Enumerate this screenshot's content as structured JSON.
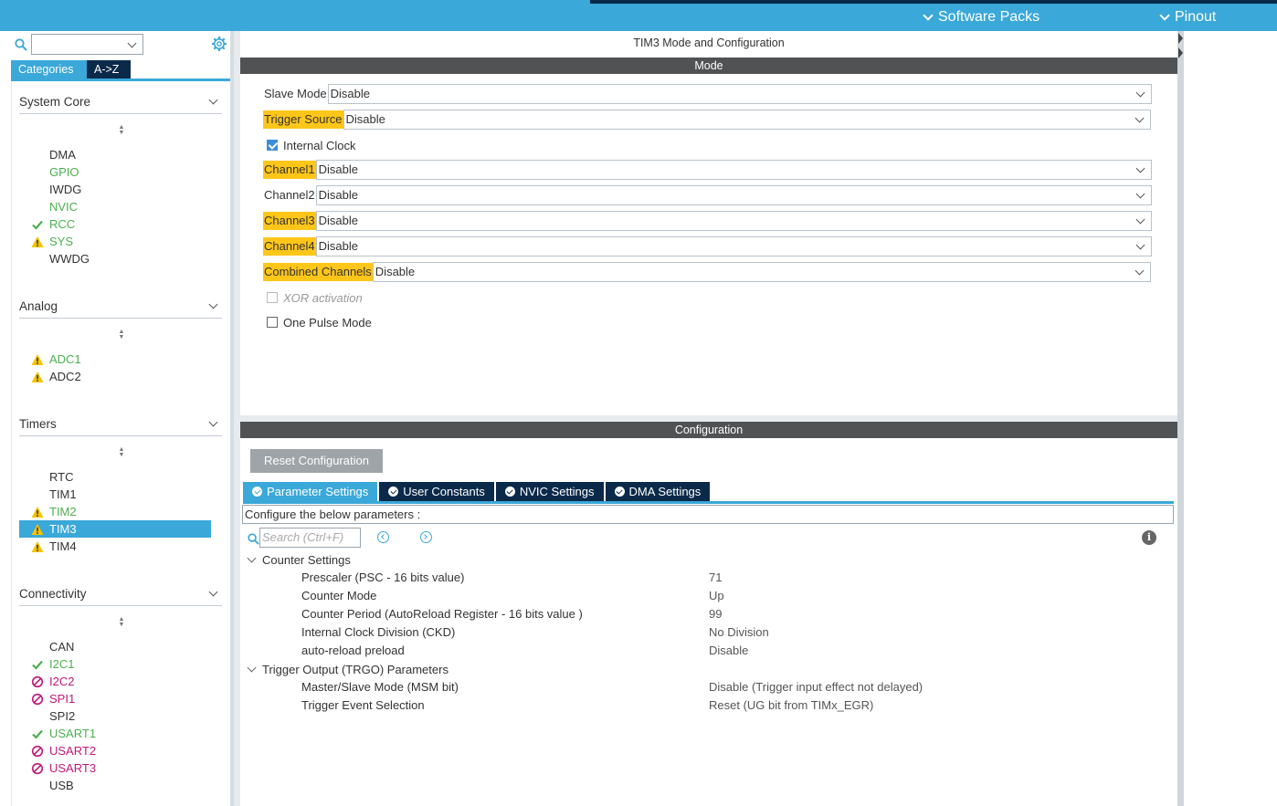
{
  "topbar": {
    "software_packs": "Software Packs",
    "pinout": "Pinout"
  },
  "left": {
    "tabs": {
      "categories": "Categories",
      "az": "A->Z"
    },
    "categories": [
      {
        "name": "System Core",
        "items": [
          {
            "label": "DMA",
            "status": "none",
            "color": "black"
          },
          {
            "label": "GPIO",
            "status": "none",
            "color": "green"
          },
          {
            "label": "IWDG",
            "status": "none",
            "color": "black"
          },
          {
            "label": "NVIC",
            "status": "none",
            "color": "green"
          },
          {
            "label": "RCC",
            "status": "check",
            "color": "green"
          },
          {
            "label": "SYS",
            "status": "warning",
            "color": "green"
          },
          {
            "label": "WWDG",
            "status": "none",
            "color": "black"
          }
        ]
      },
      {
        "name": "Analog",
        "items": [
          {
            "label": "ADC1",
            "status": "warning",
            "color": "green"
          },
          {
            "label": "ADC2",
            "status": "warning",
            "color": "black"
          }
        ]
      },
      {
        "name": "Timers",
        "items": [
          {
            "label": "RTC",
            "status": "none",
            "color": "black"
          },
          {
            "label": "TIM1",
            "status": "none",
            "color": "black"
          },
          {
            "label": "TIM2",
            "status": "warning",
            "color": "green"
          },
          {
            "label": "TIM3",
            "status": "warning",
            "color": "selected"
          },
          {
            "label": "TIM4",
            "status": "warning",
            "color": "black"
          }
        ]
      },
      {
        "name": "Connectivity",
        "items": [
          {
            "label": "CAN",
            "status": "none",
            "color": "black"
          },
          {
            "label": "I2C1",
            "status": "check",
            "color": "green"
          },
          {
            "label": "I2C2",
            "status": "blocked",
            "color": "magenta"
          },
          {
            "label": "SPI1",
            "status": "blocked",
            "color": "magenta"
          },
          {
            "label": "SPI2",
            "status": "none",
            "color": "black"
          },
          {
            "label": "USART1",
            "status": "check",
            "color": "green"
          },
          {
            "label": "USART2",
            "status": "blocked",
            "color": "magenta"
          },
          {
            "label": "USART3",
            "status": "blocked",
            "color": "magenta"
          },
          {
            "label": "USB",
            "status": "none",
            "color": "black"
          }
        ]
      }
    ]
  },
  "main": {
    "title": "TIM3 Mode and Configuration",
    "mode_bar": "Mode",
    "mode_rows": {
      "slave_mode": {
        "label": "Slave Mode",
        "value": "Disable"
      },
      "trigger_source": {
        "label": "Trigger Source",
        "value": "Disable"
      },
      "internal_clock": {
        "label": "Internal Clock",
        "checked": true
      },
      "channel1": {
        "label": "Channel1",
        "value": "Disable"
      },
      "channel2": {
        "label": "Channel2",
        "value": "Disable"
      },
      "channel3": {
        "label": "Channel3",
        "value": "Disable"
      },
      "channel4": {
        "label": "Channel4",
        "value": "Disable"
      },
      "combined": {
        "label": "Combined Channels",
        "value": "Disable"
      },
      "xor": {
        "label": "XOR activation"
      },
      "one_pulse": {
        "label": "One Pulse Mode"
      }
    },
    "config_bar": "Configuration",
    "reset_button": "Reset Configuration",
    "tabs": {
      "parameter": "Parameter Settings",
      "user_constants": "User Constants",
      "nvic": "NVIC Settings",
      "dma": "DMA Settings"
    },
    "hint": "Configure the below parameters :",
    "search_placeholder": "Search (Ctrl+F)",
    "groups": {
      "counter": {
        "title": "Counter Settings",
        "params": [
          {
            "name": "Prescaler (PSC - 16 bits value)",
            "value": "71"
          },
          {
            "name": "Counter Mode",
            "value": "Up"
          },
          {
            "name": "Counter Period (AutoReload Register - 16 bits value )",
            "value": "99"
          },
          {
            "name": "Internal Clock Division (CKD)",
            "value": "No Division"
          },
          {
            "name": "auto-reload preload",
            "value": "Disable"
          }
        ]
      },
      "trgo": {
        "title": "Trigger Output (TRGO) Parameters",
        "params": [
          {
            "name": "Master/Slave Mode (MSM bit)",
            "value": "Disable (Trigger input effect not delayed)"
          },
          {
            "name": "Trigger Event Selection",
            "value": "Reset (UG bit from TIMx_EGR)"
          }
        ]
      }
    }
  },
  "colors": {
    "accent": "#3aa8d8",
    "navy": "#0b2a4a",
    "highlight": "#ffc61a",
    "ok_green": "#4caf50",
    "blocked_magenta": "#c0187a",
    "warning_yellow": "#f5c400"
  }
}
